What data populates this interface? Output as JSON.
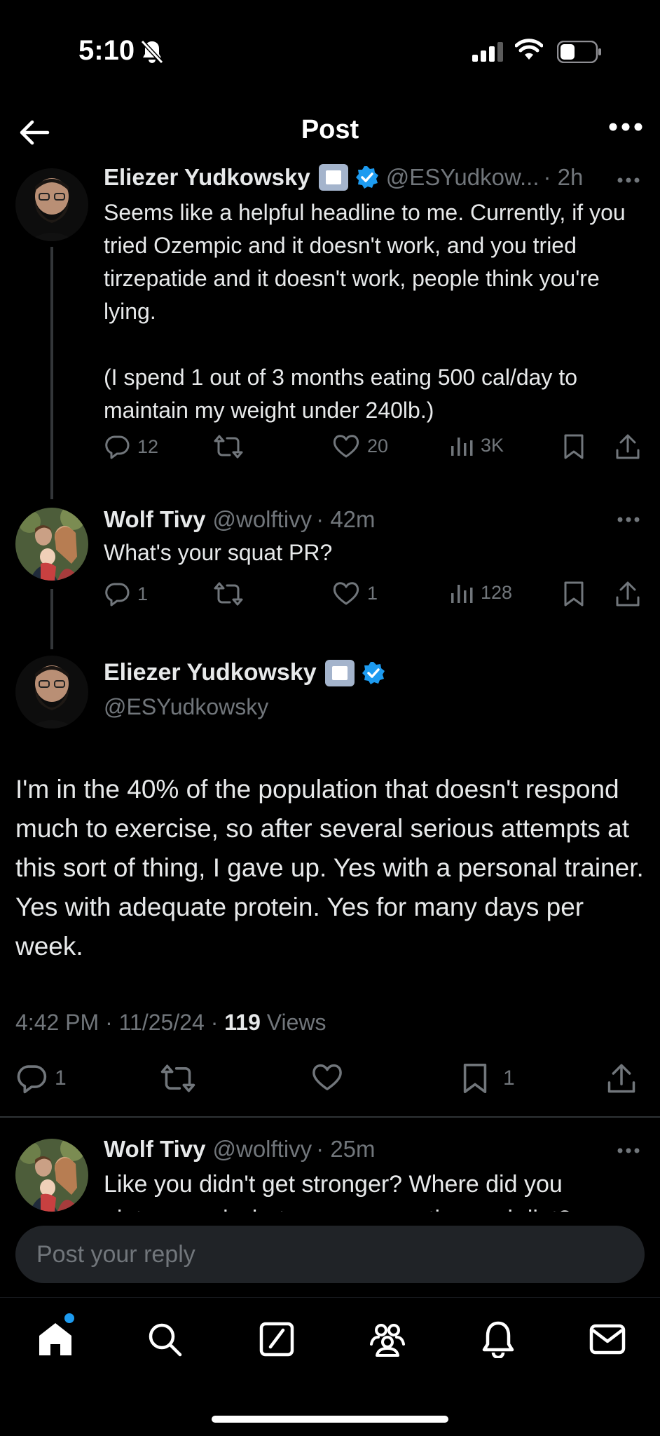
{
  "status_bar": {
    "time": "5:10"
  },
  "header": {
    "title": "Post"
  },
  "thread": [
    {
      "name": "Eliezer Yudkowsky",
      "handle": "@ESYudkow...",
      "time": "· 2h",
      "text_lines": [
        "Seems like a helpful headline to me.  Currently, if you tried Ozempic and it doesn't work, and you tried tirzepatide and it doesn't work, people think you're lying.",
        "(I spend 1 out of 3 months eating 500 cal/day to maintain my weight under 240lb.)"
      ],
      "replies": "12",
      "reposts": "",
      "likes": "20",
      "views": "3K"
    },
    {
      "name": "Wolf Tivy",
      "handle": "@wolftivy",
      "time": "· 42m",
      "text": "What's your squat PR?",
      "replies": "1",
      "reposts": "",
      "likes": "1",
      "views": "128"
    }
  ],
  "main_post": {
    "name": "Eliezer Yudkowsky",
    "handle": "@ESYudkowsky",
    "text": "I'm in the 40% of the population that doesn't respond much to exercise, so after several serious attempts at this sort of thing, I gave up. Yes with a personal trainer.  Yes with adequate protein.  Yes for many days per week.",
    "meta_prefix": "4:42 PM · 11/25/24 · ",
    "views": "119",
    "views_label": " Views",
    "replies": "1",
    "bookmarks": "1"
  },
  "reply_preview": {
    "name": "Wolf Tivy",
    "handle": "@wolftivy",
    "time": "· 25m",
    "text": "Like you didn't get stronger? Where did you plateau and what was your routine and diet?"
  },
  "reply_box": {
    "placeholder": "Post your reply"
  },
  "colors": {
    "accent": "#1d9bf0",
    "background": "#000000",
    "muted": "#71767b"
  },
  "icons": [
    "back-arrow-icon",
    "more-icon",
    "reply-icon",
    "repost-icon",
    "like-icon",
    "views-icon",
    "bookmark-icon",
    "share-icon",
    "home-icon",
    "search-icon",
    "compose-icon",
    "communities-icon",
    "notifications-icon",
    "messages-icon"
  ]
}
